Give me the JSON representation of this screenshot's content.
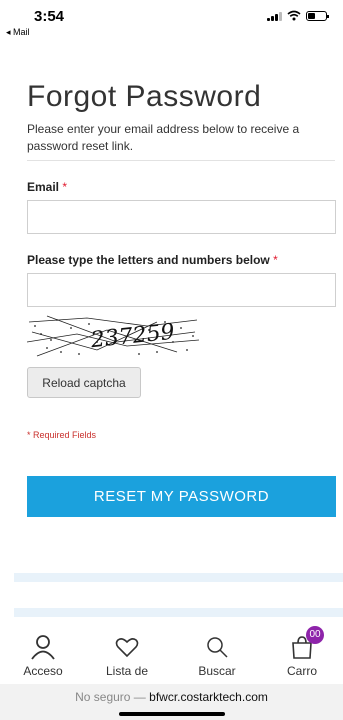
{
  "status_bar": {
    "time": "3:54",
    "back_app": "◂ Mail"
  },
  "page": {
    "title": "Forgot Password",
    "intro": "Please enter your email address below to receive a password reset link."
  },
  "form": {
    "email_label": "Email",
    "email_value": "",
    "captcha_label": "Please type the letters and numbers below",
    "captcha_value": "",
    "required_star": "*",
    "reload_button": "Reload captcha",
    "required_note": "* Required Fields",
    "submit_button": "RESET MY PASSWORD"
  },
  "bottom_nav": {
    "items": [
      {
        "label": "Acceso",
        "icon": "user-icon"
      },
      {
        "label": "Lista de",
        "icon": "heart-icon"
      },
      {
        "label": "Buscar",
        "icon": "search-icon"
      },
      {
        "label": "Carro",
        "icon": "cart-icon",
        "badge": "00"
      }
    ]
  },
  "url_bar": {
    "insecure_text": "No seguro — ",
    "host": "bfwcr.costarktech.com"
  },
  "colors": {
    "accent": "#1ba1dd",
    "required": "#e0182d",
    "badge": "#8e24aa"
  }
}
